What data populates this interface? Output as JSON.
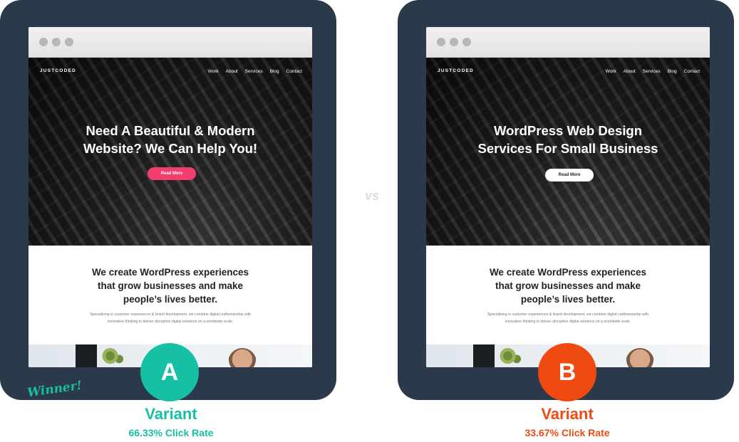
{
  "site": {
    "logo": "JUSTCODED",
    "nav": [
      "Work",
      "About",
      "Services",
      "Blog",
      "Contact"
    ],
    "cta_label": "Read More",
    "content_title": [
      "We create WordPress experiences",
      "that grow businesses and make",
      "people’s lives better."
    ],
    "content_body": [
      "Specialising in customer experiences & brand development, we combine digital craftsmanship with",
      "innovative thinking to deliver disruptive digital solutions on a worldwide scale."
    ]
  },
  "variant_a": {
    "badge": "A",
    "headline": [
      "Need A Beautiful & Modern",
      "Website? We Can Help You!"
    ],
    "cta_color": "#f23d6d",
    "label": "Variant",
    "click_rate": "66.33% Click Rate",
    "tag": "Winner!",
    "accent": "#17bfa4"
  },
  "variant_b": {
    "badge": "B",
    "headline": [
      "WordPress Web Design",
      "Services For Small Business"
    ],
    "cta_color": "#ffffff",
    "label": "Variant",
    "click_rate": "33.67% Click Rate",
    "accent": "#ee4a12"
  },
  "colors": {
    "panel": "#2b3a4a"
  }
}
